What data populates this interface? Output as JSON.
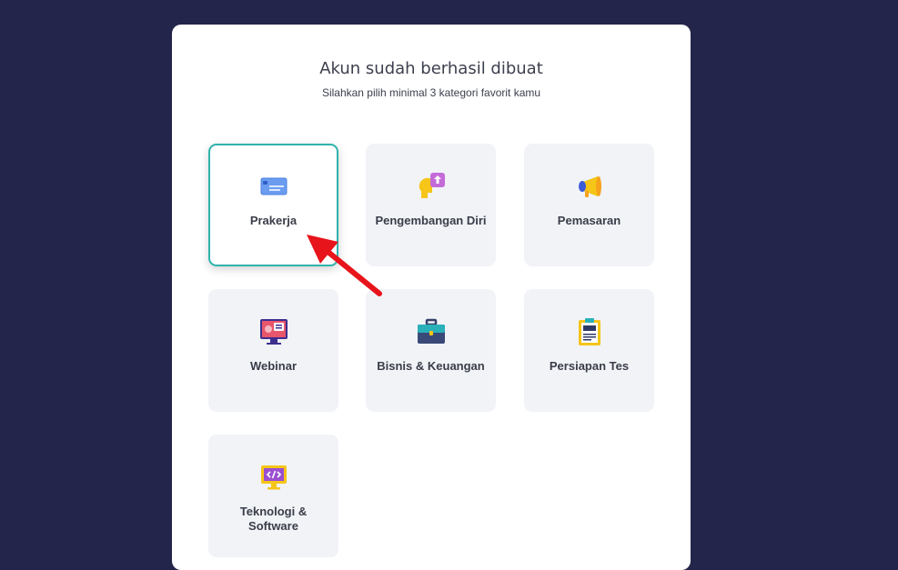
{
  "modal": {
    "title": "Akun sudah berhasil dibuat",
    "subtitle": "Silahkan pilih minimal 3 kategori favorit kamu"
  },
  "categories": [
    {
      "label": "Prakerja",
      "icon": "credit-card-icon",
      "selected": true
    },
    {
      "label": "Pengembangan Diri",
      "icon": "head-growth-icon",
      "selected": false
    },
    {
      "label": "Pemasaran",
      "icon": "megaphone-icon",
      "selected": false
    },
    {
      "label": "Webinar",
      "icon": "monitor-presentation-icon",
      "selected": false
    },
    {
      "label": "Bisnis & Keuangan",
      "icon": "briefcase-icon",
      "selected": false
    },
    {
      "label": "Persiapan Tes",
      "icon": "clipboard-icon",
      "selected": false
    },
    {
      "label": "Teknologi & Software",
      "icon": "code-monitor-icon",
      "selected": false
    }
  ],
  "colors": {
    "background": "#23254a",
    "selected_border": "#2fb3ad",
    "card_bg": "#f1f3f7",
    "annotation_arrow": "#e8141b"
  }
}
